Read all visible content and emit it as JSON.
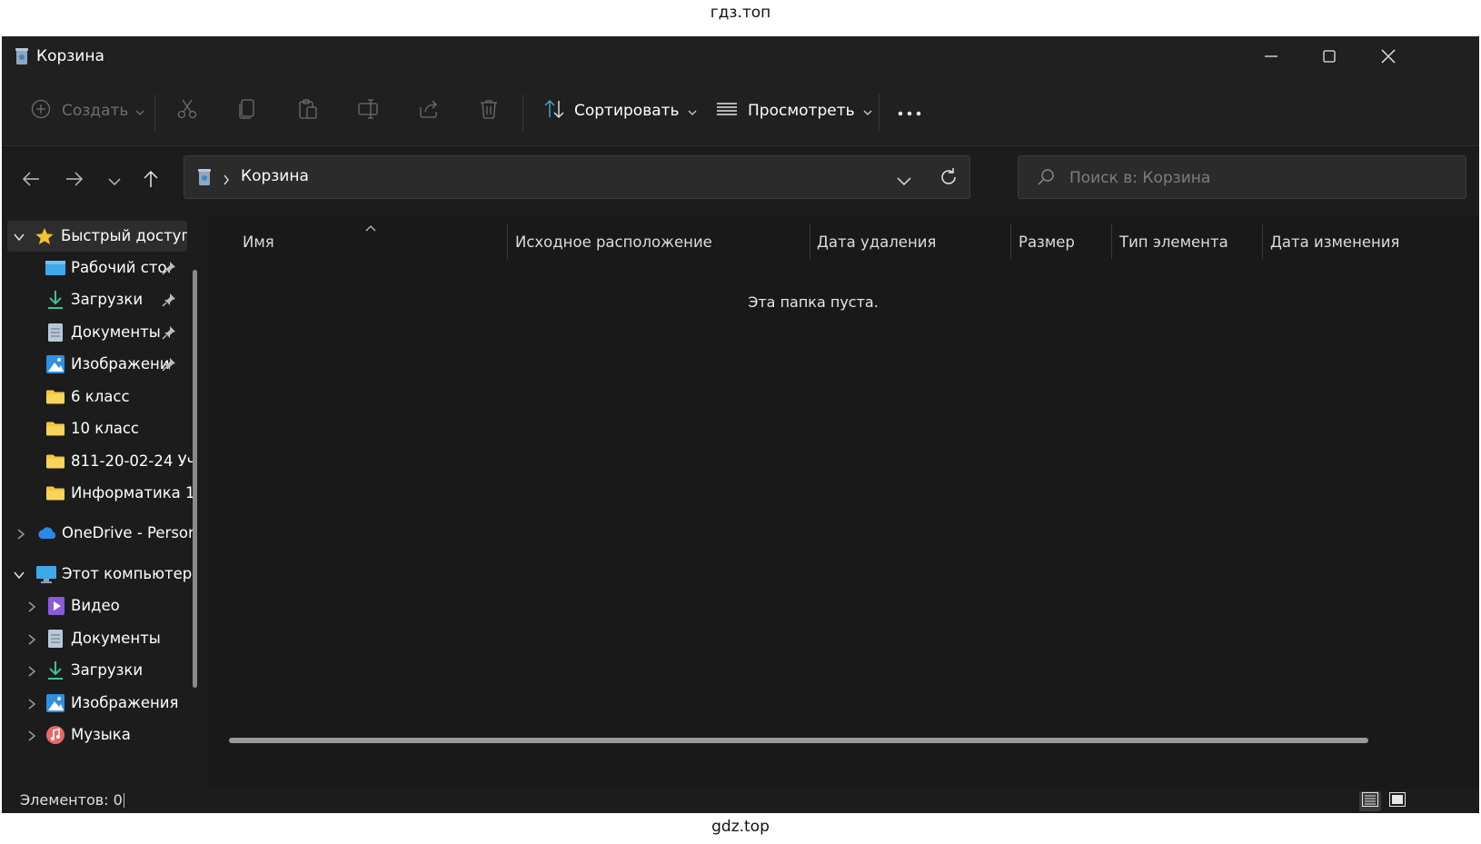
{
  "watermark": {
    "top": "гдз.топ",
    "bottom": "gdz.top"
  },
  "window": {
    "title": "Корзина",
    "controls": [
      "minimize-icon",
      "maximize-icon",
      "close-icon"
    ]
  },
  "toolbar": {
    "new_label": "Создать",
    "sort_label": "Сортировать",
    "view_label": "Просмотреть",
    "icons": [
      "cut-icon",
      "copy-icon",
      "paste-icon",
      "rename-icon",
      "share-icon",
      "delete-icon",
      "more-icon"
    ]
  },
  "address": {
    "path": "Корзина",
    "search_placeholder": "Поиск в: Корзина"
  },
  "sidebar": {
    "quick_access": "Быстрый доступ",
    "quick_items": [
      {
        "label": "Рабочий сто.",
        "icon": "desktop-icon",
        "pinned": true
      },
      {
        "label": "Загрузки",
        "icon": "download-icon",
        "pinned": true
      },
      {
        "label": "Документы",
        "icon": "document-icon",
        "pinned": true
      },
      {
        "label": "Изображени",
        "icon": "pictures-icon",
        "pinned": true
      },
      {
        "label": "6 класс",
        "icon": "folder-icon",
        "pinned": false
      },
      {
        "label": "10 класс",
        "icon": "folder-icon",
        "pinned": false
      },
      {
        "label": "811-20-02-24 Уч",
        "icon": "folder-icon",
        "pinned": false
      },
      {
        "label": "Информатика 1",
        "icon": "folder-icon",
        "pinned": false
      }
    ],
    "onedrive": "OneDrive - Person",
    "this_pc": "Этот компьютер",
    "pc_items": [
      {
        "label": "Видео",
        "icon": "video-icon"
      },
      {
        "label": "Документы",
        "icon": "document-icon"
      },
      {
        "label": "Загрузки",
        "icon": "download-icon"
      },
      {
        "label": "Изображения",
        "icon": "pictures-icon"
      },
      {
        "label": "Музыка",
        "icon": "music-icon"
      }
    ]
  },
  "columns": [
    "Имя",
    "Исходное расположение",
    "Дата удаления",
    "Размер",
    "Тип элемента",
    "Дата изменения"
  ],
  "empty_message": "Эта папка пуста.",
  "status": {
    "items_count": "Элементов: 0"
  },
  "colors": {
    "window_bg": "#1c1c1c",
    "toolbar_bg": "#202020",
    "folder": "#f4c542",
    "accent": "#4aa3df"
  }
}
